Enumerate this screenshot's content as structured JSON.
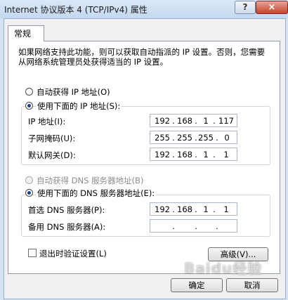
{
  "window": {
    "title": "Internet 协议版本 4 (TCP/IPv4) 属性",
    "help_label": "?",
    "close_label": "×"
  },
  "tabs": [
    {
      "label": "常规"
    }
  ],
  "description": "如果网络支持此功能，则可以获取自动指派的 IP 设置。否则，您需要从网络系统管理员处获得适当的 IP 设置。",
  "ip_section": {
    "auto_label": "自动获得 IP 地址(O)",
    "manual_label": "使用下面的 IP 地址(S):",
    "selected": "manual",
    "fields": [
      {
        "label": "IP 地址(I):",
        "octets": [
          "192",
          "168",
          "1",
          "117"
        ]
      },
      {
        "label": "子网掩码(U):",
        "octets": [
          "255",
          "255",
          "255",
          "0"
        ]
      },
      {
        "label": "默认网关(D):",
        "octets": [
          "192",
          "168",
          "1",
          "1"
        ]
      }
    ]
  },
  "dns_section": {
    "auto_label": "自动获得 DNS 服务器地址(B)",
    "manual_label": "使用下面的 DNS 服务器地址(E):",
    "selected": "manual",
    "fields": [
      {
        "label": "首选 DNS 服务器(P):",
        "octets": [
          "192",
          "168",
          "1",
          "1"
        ]
      },
      {
        "label": "备用 DNS 服务器(A):",
        "octets": [
          "",
          "",
          "",
          ""
        ]
      }
    ]
  },
  "validate_checkbox": {
    "label": "退出时验证设置(L)",
    "checked": false
  },
  "advanced_button": "高级(V)...",
  "ok_button": "确定",
  "cancel_button": "取消",
  "watermark": "Baidu经验"
}
